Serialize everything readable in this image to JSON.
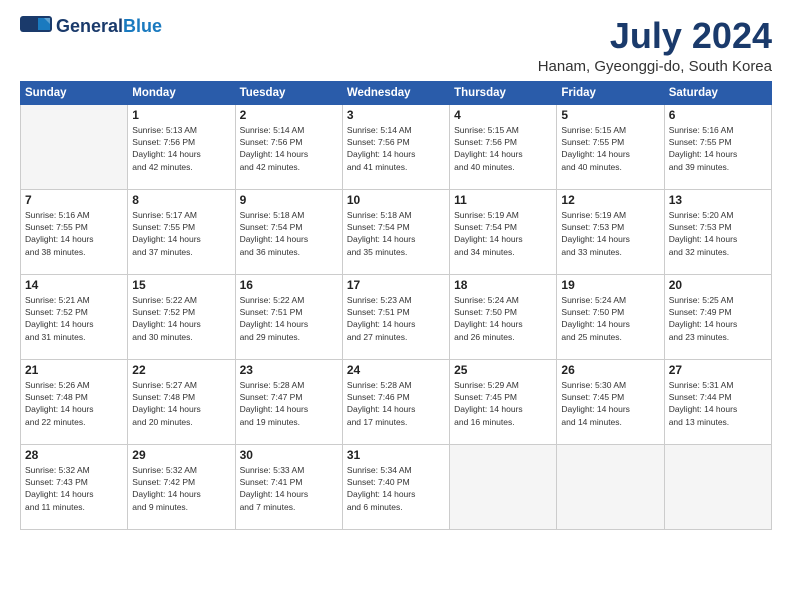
{
  "header": {
    "logo_general": "General",
    "logo_blue": "Blue",
    "month": "July 2024",
    "location": "Hanam, Gyeonggi-do, South Korea"
  },
  "days": [
    "Sunday",
    "Monday",
    "Tuesday",
    "Wednesday",
    "Thursday",
    "Friday",
    "Saturday"
  ],
  "weeks": [
    [
      {
        "day": "",
        "info": ""
      },
      {
        "day": "1",
        "info": "Sunrise: 5:13 AM\nSunset: 7:56 PM\nDaylight: 14 hours\nand 42 minutes."
      },
      {
        "day": "2",
        "info": "Sunrise: 5:14 AM\nSunset: 7:56 PM\nDaylight: 14 hours\nand 42 minutes."
      },
      {
        "day": "3",
        "info": "Sunrise: 5:14 AM\nSunset: 7:56 PM\nDaylight: 14 hours\nand 41 minutes."
      },
      {
        "day": "4",
        "info": "Sunrise: 5:15 AM\nSunset: 7:56 PM\nDaylight: 14 hours\nand 40 minutes."
      },
      {
        "day": "5",
        "info": "Sunrise: 5:15 AM\nSunset: 7:55 PM\nDaylight: 14 hours\nand 40 minutes."
      },
      {
        "day": "6",
        "info": "Sunrise: 5:16 AM\nSunset: 7:55 PM\nDaylight: 14 hours\nand 39 minutes."
      }
    ],
    [
      {
        "day": "7",
        "info": "Sunrise: 5:16 AM\nSunset: 7:55 PM\nDaylight: 14 hours\nand 38 minutes."
      },
      {
        "day": "8",
        "info": "Sunrise: 5:17 AM\nSunset: 7:55 PM\nDaylight: 14 hours\nand 37 minutes."
      },
      {
        "day": "9",
        "info": "Sunrise: 5:18 AM\nSunset: 7:54 PM\nDaylight: 14 hours\nand 36 minutes."
      },
      {
        "day": "10",
        "info": "Sunrise: 5:18 AM\nSunset: 7:54 PM\nDaylight: 14 hours\nand 35 minutes."
      },
      {
        "day": "11",
        "info": "Sunrise: 5:19 AM\nSunset: 7:54 PM\nDaylight: 14 hours\nand 34 minutes."
      },
      {
        "day": "12",
        "info": "Sunrise: 5:19 AM\nSunset: 7:53 PM\nDaylight: 14 hours\nand 33 minutes."
      },
      {
        "day": "13",
        "info": "Sunrise: 5:20 AM\nSunset: 7:53 PM\nDaylight: 14 hours\nand 32 minutes."
      }
    ],
    [
      {
        "day": "14",
        "info": "Sunrise: 5:21 AM\nSunset: 7:52 PM\nDaylight: 14 hours\nand 31 minutes."
      },
      {
        "day": "15",
        "info": "Sunrise: 5:22 AM\nSunset: 7:52 PM\nDaylight: 14 hours\nand 30 minutes."
      },
      {
        "day": "16",
        "info": "Sunrise: 5:22 AM\nSunset: 7:51 PM\nDaylight: 14 hours\nand 29 minutes."
      },
      {
        "day": "17",
        "info": "Sunrise: 5:23 AM\nSunset: 7:51 PM\nDaylight: 14 hours\nand 27 minutes."
      },
      {
        "day": "18",
        "info": "Sunrise: 5:24 AM\nSunset: 7:50 PM\nDaylight: 14 hours\nand 26 minutes."
      },
      {
        "day": "19",
        "info": "Sunrise: 5:24 AM\nSunset: 7:50 PM\nDaylight: 14 hours\nand 25 minutes."
      },
      {
        "day": "20",
        "info": "Sunrise: 5:25 AM\nSunset: 7:49 PM\nDaylight: 14 hours\nand 23 minutes."
      }
    ],
    [
      {
        "day": "21",
        "info": "Sunrise: 5:26 AM\nSunset: 7:48 PM\nDaylight: 14 hours\nand 22 minutes."
      },
      {
        "day": "22",
        "info": "Sunrise: 5:27 AM\nSunset: 7:48 PM\nDaylight: 14 hours\nand 20 minutes."
      },
      {
        "day": "23",
        "info": "Sunrise: 5:28 AM\nSunset: 7:47 PM\nDaylight: 14 hours\nand 19 minutes."
      },
      {
        "day": "24",
        "info": "Sunrise: 5:28 AM\nSunset: 7:46 PM\nDaylight: 14 hours\nand 17 minutes."
      },
      {
        "day": "25",
        "info": "Sunrise: 5:29 AM\nSunset: 7:45 PM\nDaylight: 14 hours\nand 16 minutes."
      },
      {
        "day": "26",
        "info": "Sunrise: 5:30 AM\nSunset: 7:45 PM\nDaylight: 14 hours\nand 14 minutes."
      },
      {
        "day": "27",
        "info": "Sunrise: 5:31 AM\nSunset: 7:44 PM\nDaylight: 14 hours\nand 13 minutes."
      }
    ],
    [
      {
        "day": "28",
        "info": "Sunrise: 5:32 AM\nSunset: 7:43 PM\nDaylight: 14 hours\nand 11 minutes."
      },
      {
        "day": "29",
        "info": "Sunrise: 5:32 AM\nSunset: 7:42 PM\nDaylight: 14 hours\nand 9 minutes."
      },
      {
        "day": "30",
        "info": "Sunrise: 5:33 AM\nSunset: 7:41 PM\nDaylight: 14 hours\nand 7 minutes."
      },
      {
        "day": "31",
        "info": "Sunrise: 5:34 AM\nSunset: 7:40 PM\nDaylight: 14 hours\nand 6 minutes."
      },
      {
        "day": "",
        "info": ""
      },
      {
        "day": "",
        "info": ""
      },
      {
        "day": "",
        "info": ""
      }
    ]
  ]
}
